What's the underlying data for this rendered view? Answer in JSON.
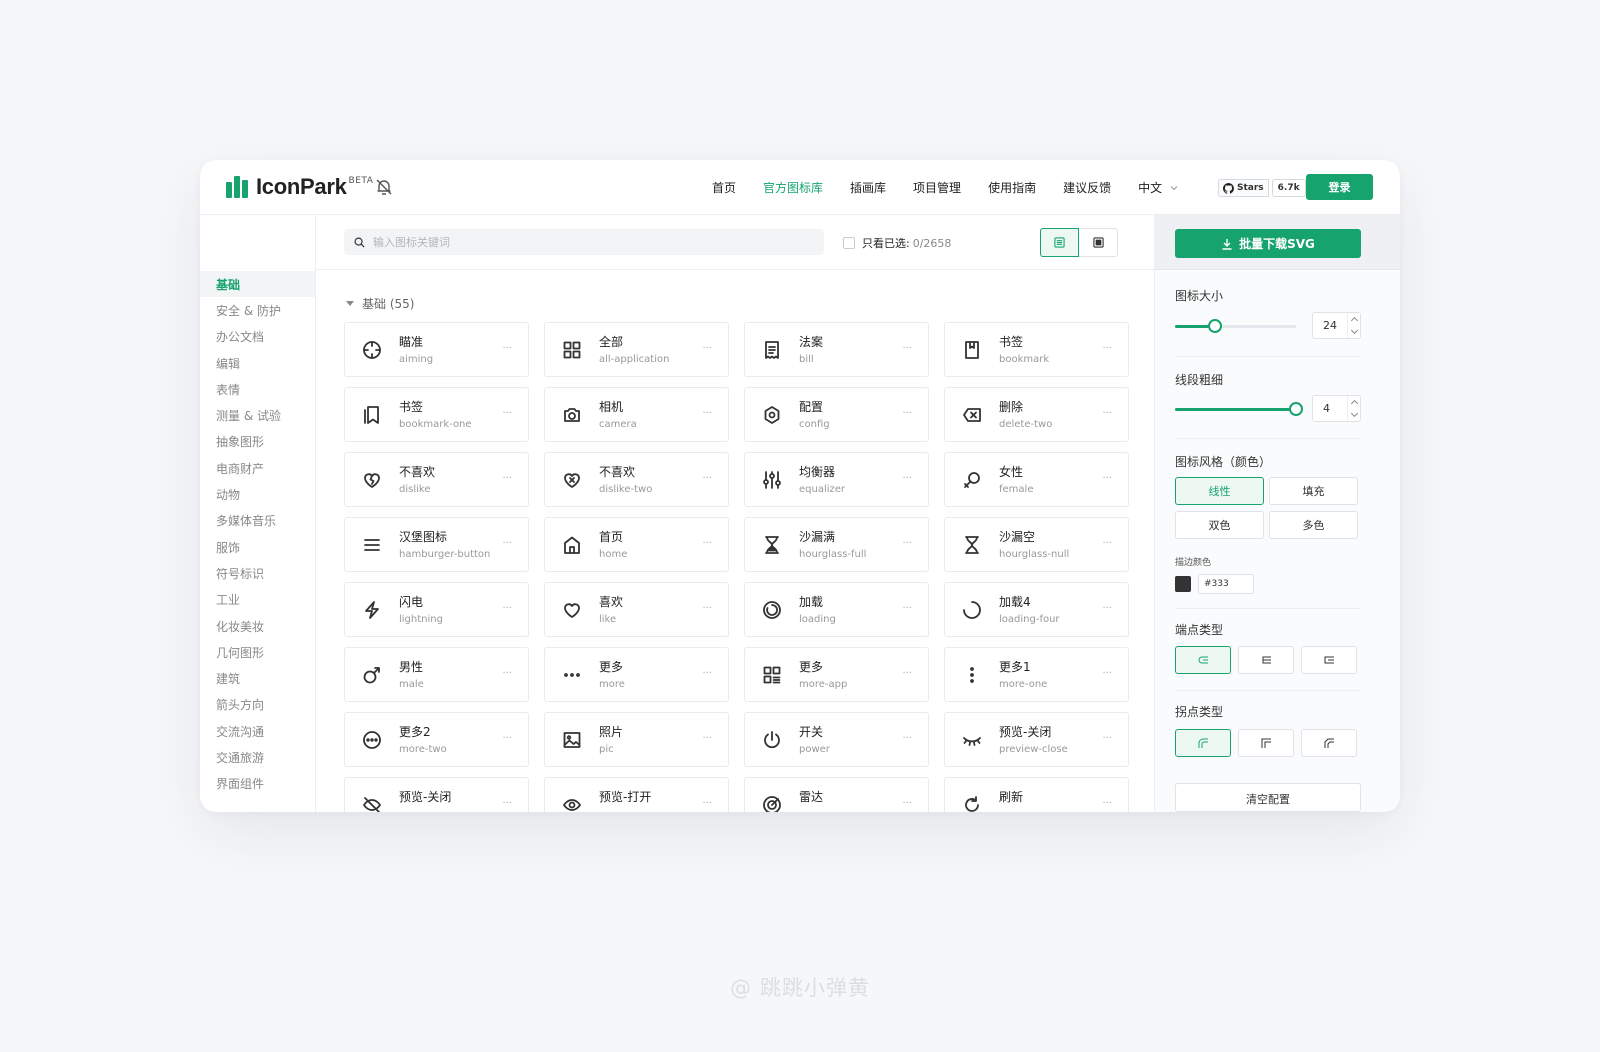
{
  "brand": {
    "name": "IconPark",
    "badge": "BETA",
    "accent": "#17a36e"
  },
  "nav": {
    "items": [
      {
        "label": "首页",
        "active": false
      },
      {
        "label": "官方图标库",
        "active": true
      },
      {
        "label": "插画库",
        "active": false
      },
      {
        "label": "项目管理",
        "active": false
      },
      {
        "label": "使用指南",
        "active": false
      },
      {
        "label": "建议反馈",
        "active": false
      }
    ],
    "language": "中文",
    "github": {
      "label": "Stars",
      "count": "6.7k"
    },
    "login": "登录"
  },
  "sidebar": {
    "items": [
      "基础",
      "安全 & 防护",
      "办公文档",
      "编辑",
      "表情",
      "测量 & 试验",
      "抽象图形",
      "电商财产",
      "动物",
      "多媒体音乐",
      "服饰",
      "符号标识",
      "工业",
      "化妆美妆",
      "几何图形",
      "建筑",
      "箭头方向",
      "交流沟通",
      "交通旅游",
      "界面组件"
    ],
    "active_index": 0
  },
  "toolbar": {
    "search_placeholder": "输入图标关键词",
    "only_selected_label": "只看已选:",
    "selected_count": "0/2658"
  },
  "category": {
    "title": "基础 (55)"
  },
  "icons": [
    {
      "cn": "瞄准",
      "en": "aiming",
      "icon": "aiming-icon"
    },
    {
      "cn": "全部",
      "en": "all-application",
      "icon": "all-application-icon"
    },
    {
      "cn": "法案",
      "en": "bill",
      "icon": "bill-icon"
    },
    {
      "cn": "书签",
      "en": "bookmark",
      "icon": "bookmark-icon"
    },
    {
      "cn": "书签",
      "en": "bookmark-one",
      "icon": "bookmark-one-icon"
    },
    {
      "cn": "相机",
      "en": "camera",
      "icon": "camera-icon"
    },
    {
      "cn": "配置",
      "en": "config",
      "icon": "config-icon"
    },
    {
      "cn": "删除",
      "en": "delete-two",
      "icon": "delete-two-icon"
    },
    {
      "cn": "不喜欢",
      "en": "dislike",
      "icon": "dislike-icon"
    },
    {
      "cn": "不喜欢",
      "en": "dislike-two",
      "icon": "dislike-two-icon"
    },
    {
      "cn": "均衡器",
      "en": "equalizer",
      "icon": "equalizer-icon"
    },
    {
      "cn": "女性",
      "en": "female",
      "icon": "female-icon"
    },
    {
      "cn": "汉堡图标",
      "en": "hamburger-button",
      "icon": "hamburger-button-icon"
    },
    {
      "cn": "首页",
      "en": "home",
      "icon": "home-icon"
    },
    {
      "cn": "沙漏满",
      "en": "hourglass-full",
      "icon": "hourglass-full-icon"
    },
    {
      "cn": "沙漏空",
      "en": "hourglass-null",
      "icon": "hourglass-null-icon"
    },
    {
      "cn": "闪电",
      "en": "lightning",
      "icon": "lightning-icon"
    },
    {
      "cn": "喜欢",
      "en": "like",
      "icon": "like-icon"
    },
    {
      "cn": "加载",
      "en": "loading",
      "icon": "loading-icon"
    },
    {
      "cn": "加载4",
      "en": "loading-four",
      "icon": "loading-four-icon"
    },
    {
      "cn": "男性",
      "en": "male",
      "icon": "male-icon"
    },
    {
      "cn": "更多",
      "en": "more",
      "icon": "more-icon"
    },
    {
      "cn": "更多",
      "en": "more-app",
      "icon": "more-app-icon"
    },
    {
      "cn": "更多1",
      "en": "more-one",
      "icon": "more-one-icon"
    },
    {
      "cn": "更多2",
      "en": "more-two",
      "icon": "more-two-icon"
    },
    {
      "cn": "照片",
      "en": "pic",
      "icon": "pic-icon"
    },
    {
      "cn": "开关",
      "en": "power",
      "icon": "power-icon"
    },
    {
      "cn": "预览-关闭",
      "en": "preview-close",
      "icon": "preview-close-icon"
    },
    {
      "cn": "预览-关闭",
      "en": "",
      "icon": "preview-close-one-icon"
    },
    {
      "cn": "预览-打开",
      "en": "",
      "icon": "preview-open-icon"
    },
    {
      "cn": "雷达",
      "en": "",
      "icon": "radar-icon"
    },
    {
      "cn": "刷新",
      "en": "",
      "icon": "refresh-icon"
    }
  ],
  "card_more": "···",
  "panel": {
    "download_label": "批量下载SVG",
    "size_label": "图标大小",
    "size_value": "24",
    "size_fraction": 0.33,
    "stroke_label": "线段粗细",
    "stroke_value": "4",
    "stroke_fraction": 1.0,
    "style_label": "图标风格（颜色）",
    "styles": [
      "线性",
      "填充",
      "双色",
      "多色"
    ],
    "style_active": 0,
    "stroke_color_label": "描边颜色",
    "stroke_color": "#333",
    "linecap_label": "端点类型",
    "linejoin_label": "拐点类型",
    "clear_label": "清空配置"
  },
  "watermark": "@ 跳跳小弹黄"
}
